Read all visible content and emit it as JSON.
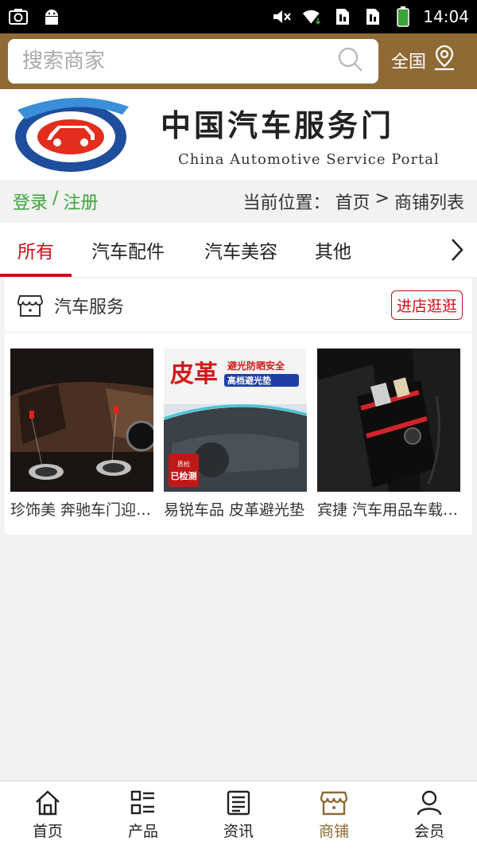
{
  "status": {
    "time": "14:04"
  },
  "search": {
    "placeholder": "搜索商家",
    "region": "全国"
  },
  "banner": {
    "title": "中国汽车服务门",
    "subtitle": "China Automotive Service Portal"
  },
  "auth": {
    "login": "登录",
    "sep": "/",
    "register": "注册"
  },
  "breadcrumb": {
    "prefix": "当前位置：",
    "home": "首页",
    "sep": ">",
    "current": "商铺列表"
  },
  "tabs": [
    {
      "label": "所有",
      "active": true
    },
    {
      "label": "汽车配件"
    },
    {
      "label": "汽车美容"
    },
    {
      "label": "其他"
    }
  ],
  "store": {
    "name": "汽车服务",
    "visit_label": "进店逛逛",
    "products": [
      {
        "title": "珍饰美 奔驰车门迎宾灯"
      },
      {
        "title": "易锐车品 皮革避光垫"
      },
      {
        "title": "宾捷 汽车用品车载收纳"
      }
    ]
  },
  "product_image_text": {
    "leather": "皮革",
    "tag1": "避光防晒安全",
    "tag2": "高档避光垫",
    "tag3": "已检测"
  },
  "bottom_nav": [
    {
      "label": "首页",
      "icon": "home-icon"
    },
    {
      "label": "产品",
      "icon": "grid-list-icon"
    },
    {
      "label": "资讯",
      "icon": "news-icon"
    },
    {
      "label": "商铺",
      "icon": "shop-icon",
      "active": true
    },
    {
      "label": "会员",
      "icon": "user-icon"
    }
  ],
  "colors": {
    "brand_brown": "#8f6a35",
    "accent_red": "#c8101a",
    "login_green": "#3aa537"
  }
}
